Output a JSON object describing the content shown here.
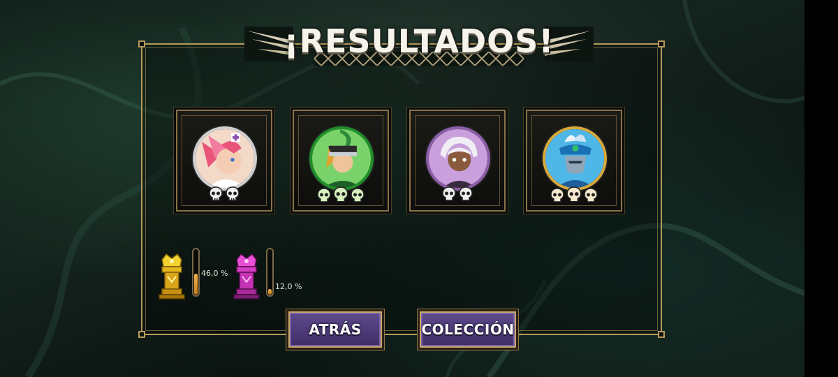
{
  "title": "¡RESULTADOS!",
  "heroes": [
    {
      "name": "hero-pink-nurse",
      "ring_color": "#cfcfcf",
      "bg_color": "#f3d9c8",
      "skulls": 2
    },
    {
      "name": "hero-green-headdress",
      "ring_color": "#1f8f2a",
      "bg_color": "#7ad36a",
      "skulls": 3
    },
    {
      "name": "hero-white-hair",
      "ring_color": "#8d5fa8",
      "bg_color": "#c9a0dc",
      "skulls": 2
    },
    {
      "name": "hero-blue-feather",
      "ring_color": "#d8a93a",
      "bg_color": "#4fb6e8",
      "skulls": 3
    }
  ],
  "trophies": [
    {
      "type": "gold-trophy-icon",
      "color": "#e5c02a",
      "progress_percent": 46.0,
      "label": "46,0 %"
    },
    {
      "type": "pink-trophy-icon",
      "color": "#e03fd0",
      "progress_percent": 12.0,
      "label": "12,0 %"
    }
  ],
  "buttons": {
    "back_label": "ATRÁS",
    "collection_label": "COLECCIÓN"
  }
}
